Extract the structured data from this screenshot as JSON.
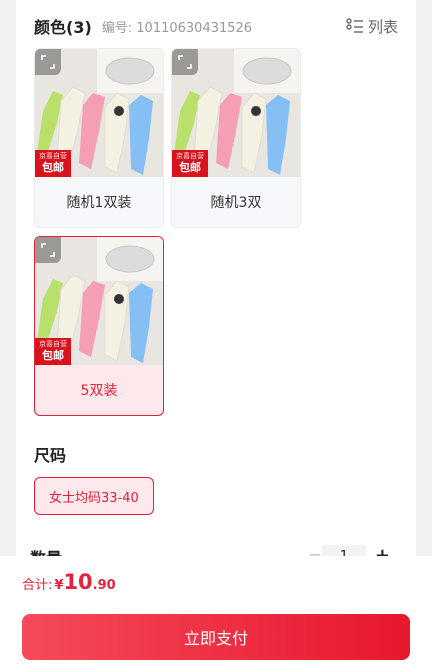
{
  "color_section": {
    "title": "颜色(3)",
    "code_text": "编号: 10110630431526",
    "view_toggle_label": "列表"
  },
  "variants": [
    {
      "label": "随机1双装",
      "promo_top": "京喜自营",
      "promo_bottom": "包邮",
      "selected": false
    },
    {
      "label": "随机3双",
      "promo_top": "京喜自营",
      "promo_bottom": "包邮",
      "selected": false
    },
    {
      "label": "5双装",
      "promo_top": "京喜自营",
      "promo_bottom": "包邮",
      "selected": true
    }
  ],
  "size_section": {
    "title": "尺码",
    "options": [
      "女士均码33-40"
    ]
  },
  "quantity": {
    "label": "数量",
    "minus": "−",
    "value": "1",
    "plus": "+"
  },
  "footer": {
    "total_label": "合计:",
    "currency": "¥",
    "price_int": "10",
    "price_dec": ".90",
    "pay_button_label": "立即支付"
  },
  "colors": {
    "accent": "#e6213a",
    "selected_bg": "#fde9ec",
    "promo_red": "#d8131d",
    "sock_green": "#b9e06a",
    "sock_pink": "#f59fb4",
    "sock_cream": "#f4f0e2",
    "sock_blue": "#86bff3"
  }
}
